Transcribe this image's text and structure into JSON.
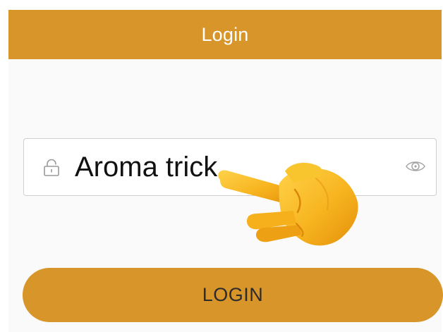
{
  "header": {
    "title": "Login"
  },
  "password_field": {
    "value": "Aroma trick",
    "lock_icon": "lock-icon",
    "visibility_icon": "eye-icon"
  },
  "hint": {
    "icon": "pointing-hand-icon"
  },
  "login_button": {
    "label": "LOGIN"
  },
  "colors": {
    "accent": "#d8952a",
    "header_text": "#ffffff",
    "button_text": "#2c2c2c",
    "field_border": "#cfcfcf"
  }
}
